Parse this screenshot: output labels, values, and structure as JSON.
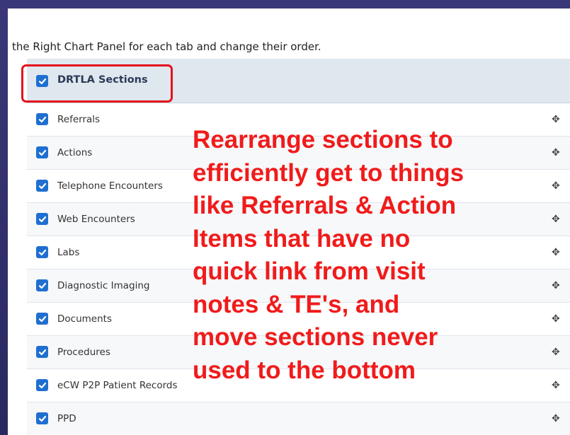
{
  "instruction_text": "the Right Chart Panel for each tab and change their order.",
  "header": {
    "label": "DRTLA Sections",
    "checked": true
  },
  "sections": [
    {
      "label": "Referrals",
      "checked": true
    },
    {
      "label": "Actions",
      "checked": true
    },
    {
      "label": "Telephone Encounters",
      "checked": true
    },
    {
      "label": "Web Encounters",
      "checked": true
    },
    {
      "label": "Labs",
      "checked": true
    },
    {
      "label": "Diagnostic Imaging",
      "checked": true
    },
    {
      "label": "Documents",
      "checked": true
    },
    {
      "label": "Procedures",
      "checked": true
    },
    {
      "label": "eCW P2P Patient Records",
      "checked": true
    },
    {
      "label": "PPD",
      "checked": true
    }
  ],
  "annotation": {
    "lines": [
      "Rearrange sections to",
      "efficiently get to things",
      "like Referrals & Action",
      "Items that have no",
      "quick link from visit",
      "notes & TE's, and",
      "move sections never",
      "used to the bottom"
    ]
  },
  "colors": {
    "accent_red": "#f01b1b",
    "checkbox_blue": "#1f6fd1",
    "slide_background": "#2f2d6b",
    "header_background": "#dfe7ef"
  },
  "icons": {
    "checkbox": "checkmark-icon",
    "drag": "drag-handle-icon"
  }
}
